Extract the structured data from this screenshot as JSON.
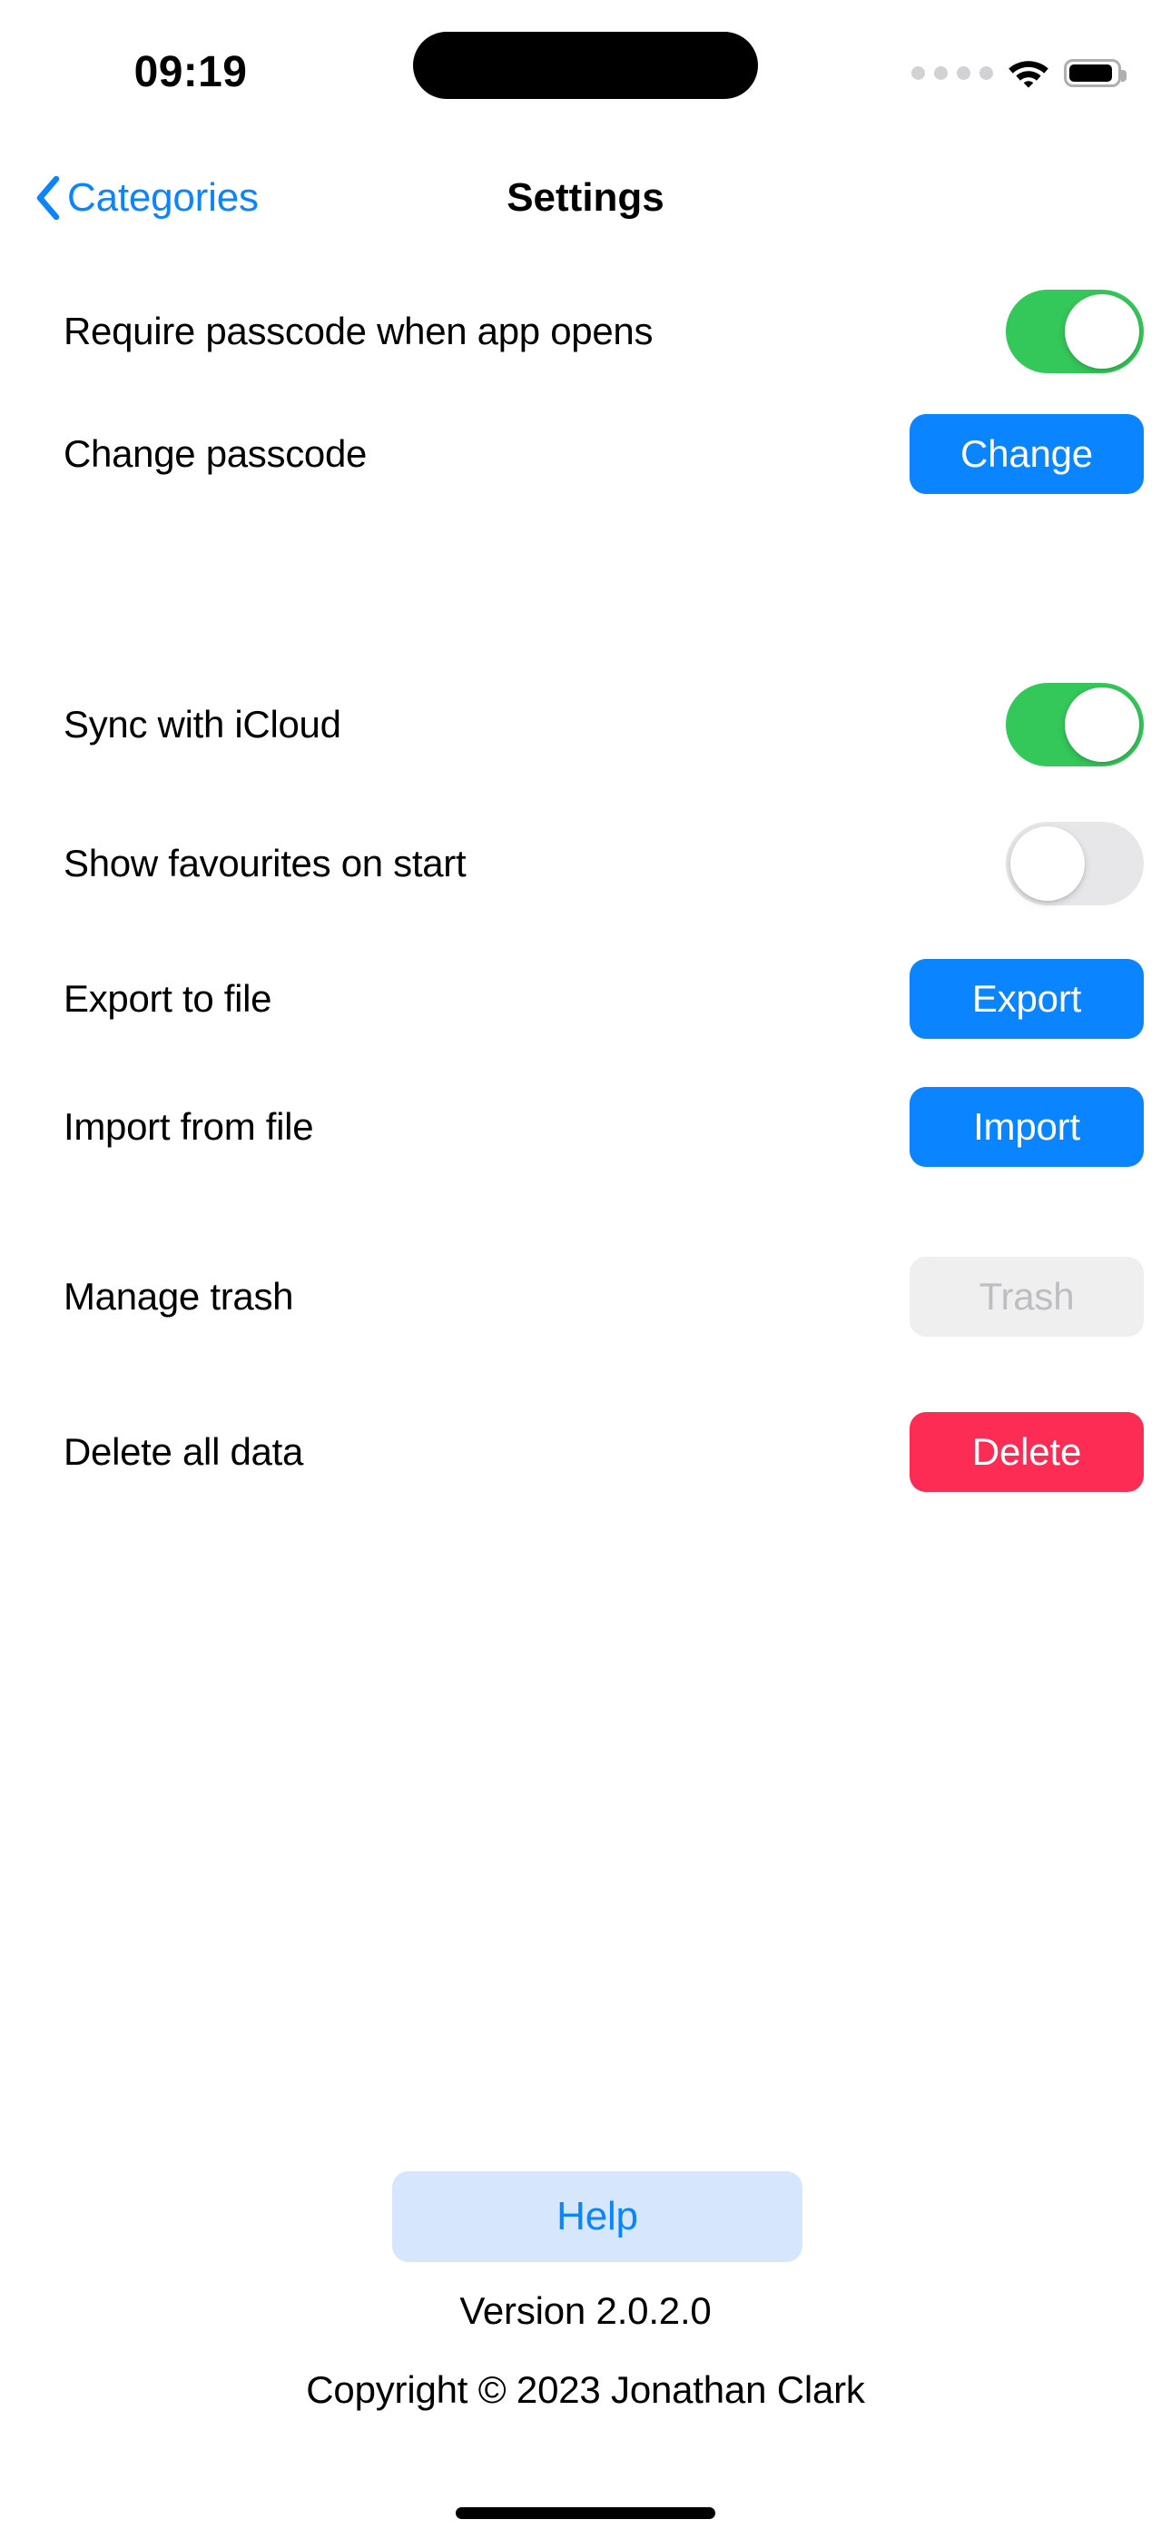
{
  "status_bar": {
    "time": "09:19",
    "cellular_icon": "cellular-dots-icon",
    "wifi_icon": "wifi-icon",
    "battery_icon": "battery-full-icon"
  },
  "nav": {
    "back_icon": "chevron-left-icon",
    "back_label": "Categories",
    "title": "Settings"
  },
  "rows": [
    {
      "label": "Require passcode when app opens",
      "control": "toggle",
      "state": "on",
      "name": "require-passcode"
    },
    {
      "label": "Change passcode",
      "control": "button",
      "button_label": "Change",
      "style": "primary",
      "name": "change-passcode"
    },
    {
      "label": "Sync with iCloud",
      "control": "toggle",
      "state": "on",
      "name": "sync-icloud"
    },
    {
      "label": "Show favourites on start",
      "control": "toggle",
      "state": "off",
      "name": "show-favourites"
    },
    {
      "label": "Export to file",
      "control": "button",
      "button_label": "Export",
      "style": "primary",
      "name": "export-file"
    },
    {
      "label": "Import from file",
      "control": "button",
      "button_label": "Import",
      "style": "primary",
      "name": "import-file"
    },
    {
      "label": "Manage trash",
      "control": "button",
      "button_label": "Trash",
      "style": "disabled",
      "name": "manage-trash"
    },
    {
      "label": "Delete all data",
      "control": "button",
      "button_label": "Delete",
      "style": "danger",
      "name": "delete-all-data"
    }
  ],
  "footer": {
    "help_label": "Help",
    "version": "Version 2.0.2.0",
    "copyright": "Copyright © 2023 Jonathan Clark"
  },
  "colors": {
    "accent_blue": "#0A84FF",
    "toggle_on_green": "#34C759",
    "toggle_off_gray": "#E7E7EA",
    "danger_red": "#FD2C55",
    "disabled_bg": "#EFEFF0",
    "disabled_text": "#BEBEC2",
    "help_bg": "#D5E6FD"
  }
}
